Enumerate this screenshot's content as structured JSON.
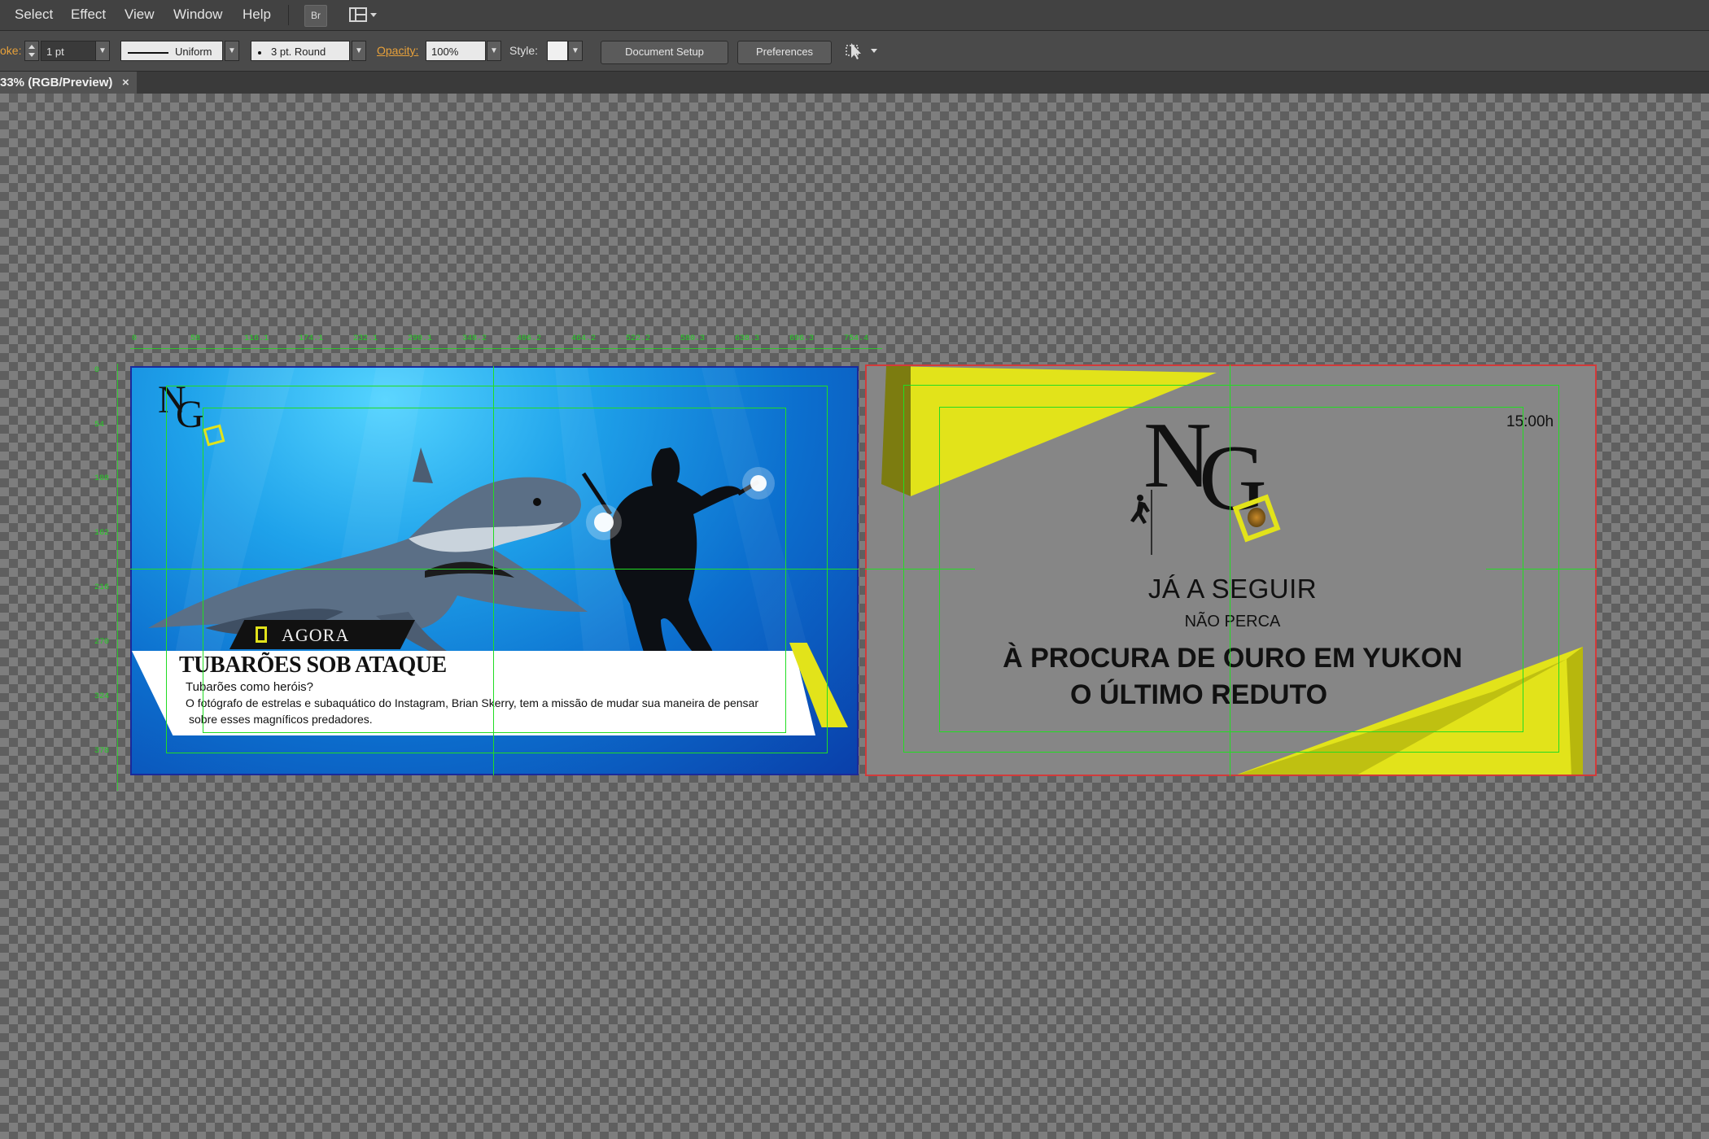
{
  "menubar": {
    "items": [
      "Select",
      "Effect",
      "View",
      "Window",
      "Help"
    ],
    "bridge_button": "Br"
  },
  "controlbar": {
    "stroke_label": "oke:",
    "stroke_weight": "1 pt",
    "profile": "Uniform",
    "brush": "3 pt. Round",
    "opacity_label": "Opacity:",
    "opacity_value": "100%",
    "style_label": "Style:",
    "document_setup": "Document Setup",
    "preferences": "Preferences"
  },
  "tab": {
    "title": "33% (RGB/Preview)",
    "close": "×"
  },
  "ruler": {
    "top_ticks": [
      "0",
      "58",
      "116.1",
      "174.1",
      "232.1",
      "290.1",
      "348.2",
      "406.2",
      "464.2",
      "522.2",
      "580.3",
      "638.3",
      "696.3",
      "754.4"
    ],
    "left_ticks": [
      "0",
      "54",
      "108",
      "162",
      "216",
      "270",
      "324",
      "378"
    ]
  },
  "artboard_left": {
    "logo": {
      "n": "N",
      "g": "G"
    },
    "now_label": "AGORA",
    "headline": "TUBARÕES SOB ATAQUE",
    "subheadline": "Tubarões como heróis?",
    "body_line1": "O fotógrafo de estrelas e subaquático do Instagram, Brian Skerry, tem a missão de mudar sua maneira de pensar",
    "body_line2": "sobre esses magníficos predadores."
  },
  "artboard_right": {
    "time": "15:00h",
    "logo": {
      "n": "N",
      "g": "G"
    },
    "up_next": "JÁ A SEGUIR",
    "dont_miss": "NÃO PERCA",
    "program1": "À PROCURA DE OURO EM YUKON",
    "program2": "O ÚLTIMO REDUTO"
  },
  "colors": {
    "accent_yellow": "#e2e31a",
    "guide_green": "#22dd22",
    "artboard_border": "#d23a3a",
    "ocean_blue": "#1a7fd0",
    "gray_slide": "#868686"
  },
  "icons": {
    "bridge": "bridge-icon",
    "workspace": "workspace-layout-icon",
    "arrange": "arrange-icon",
    "diver": "climber-silhouette-icon",
    "lion": "lion-icon"
  }
}
